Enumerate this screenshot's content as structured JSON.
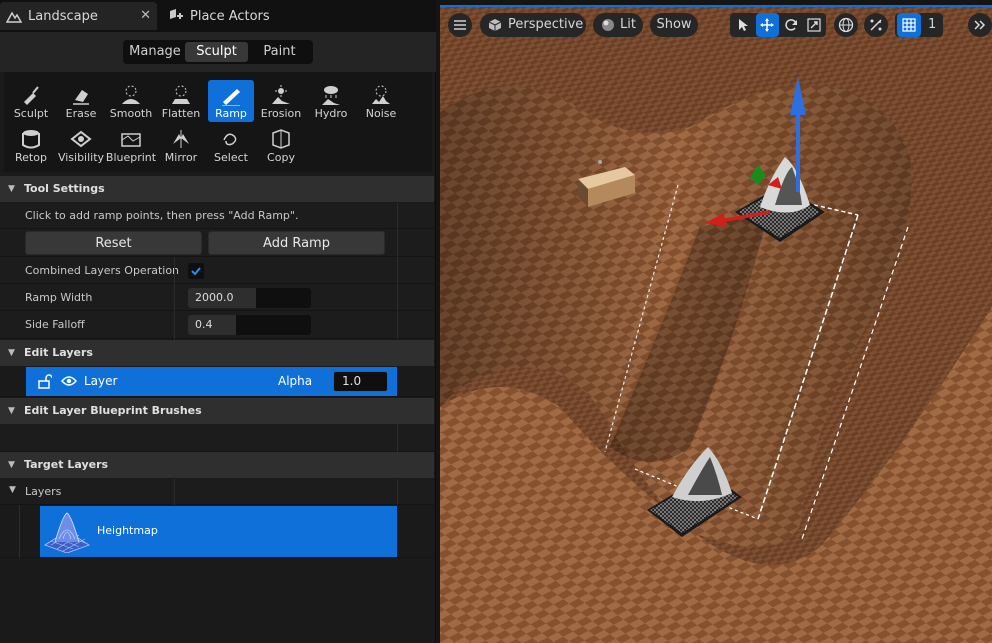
{
  "tabs": [
    {
      "label": "Landscape",
      "icon": "landscape-icon",
      "active": true,
      "close": "✕"
    },
    {
      "label": "Place Actors",
      "icon": "place-actors-icon",
      "active": false
    }
  ],
  "modes": [
    {
      "label": "Manage",
      "active": false
    },
    {
      "label": "Sculpt",
      "active": true
    },
    {
      "label": "Paint",
      "active": false
    }
  ],
  "tools": [
    {
      "label": "Sculpt",
      "icon": "sculpt-icon"
    },
    {
      "label": "Erase",
      "icon": "erase-icon"
    },
    {
      "label": "Smooth",
      "icon": "smooth-icon"
    },
    {
      "label": "Flatten",
      "icon": "flatten-icon"
    },
    {
      "label": "Ramp",
      "icon": "ramp-icon",
      "active": true
    },
    {
      "label": "Erosion",
      "icon": "erosion-icon"
    },
    {
      "label": "Hydro",
      "icon": "hydro-icon"
    },
    {
      "label": "Noise",
      "icon": "noise-icon"
    },
    {
      "label": "Retop",
      "icon": "retop-icon"
    },
    {
      "label": "Visibility",
      "icon": "visibility-icon"
    },
    {
      "label": "Blueprint",
      "icon": "blueprint-icon"
    },
    {
      "label": "Mirror",
      "icon": "mirror-icon"
    },
    {
      "label": "Select",
      "icon": "select-icon"
    },
    {
      "label": "Copy",
      "icon": "copy-icon"
    }
  ],
  "tool_settings": {
    "header": "Tool Settings",
    "hint": "Click to add ramp points, then press \"Add Ramp\".",
    "reset_label": "Reset",
    "add_ramp_label": "Add Ramp",
    "combined_label": "Combined Layers Operation",
    "combined_checked": true,
    "ramp_width_label": "Ramp Width",
    "ramp_width_value": "2000.0",
    "side_falloff_label": "Side Falloff",
    "side_falloff_value": "0.4"
  },
  "edit_layers": {
    "header": "Edit Layers",
    "layer_name": "Layer",
    "alpha_label": "Alpha",
    "alpha_value": "1.0"
  },
  "blueprint_brushes": {
    "header": "Edit Layer Blueprint Brushes"
  },
  "target_layers": {
    "header": "Target Layers",
    "layers_label": "Layers",
    "heightmap_label": "Heightmap"
  },
  "viewport": {
    "menu_icon": "hamburger-icon",
    "perspective_label": "Perspective",
    "lit_label": "Lit",
    "show_label": "Show",
    "grid_value": "1",
    "more_icon": "double-chevron-right-icon"
  },
  "colors": {
    "accent": "#0e70d8",
    "panel": "#1a1a1a",
    "section": "#2f2f2f",
    "terrain_dark": "#5a3a26",
    "terrain_light": "#9a6342"
  }
}
